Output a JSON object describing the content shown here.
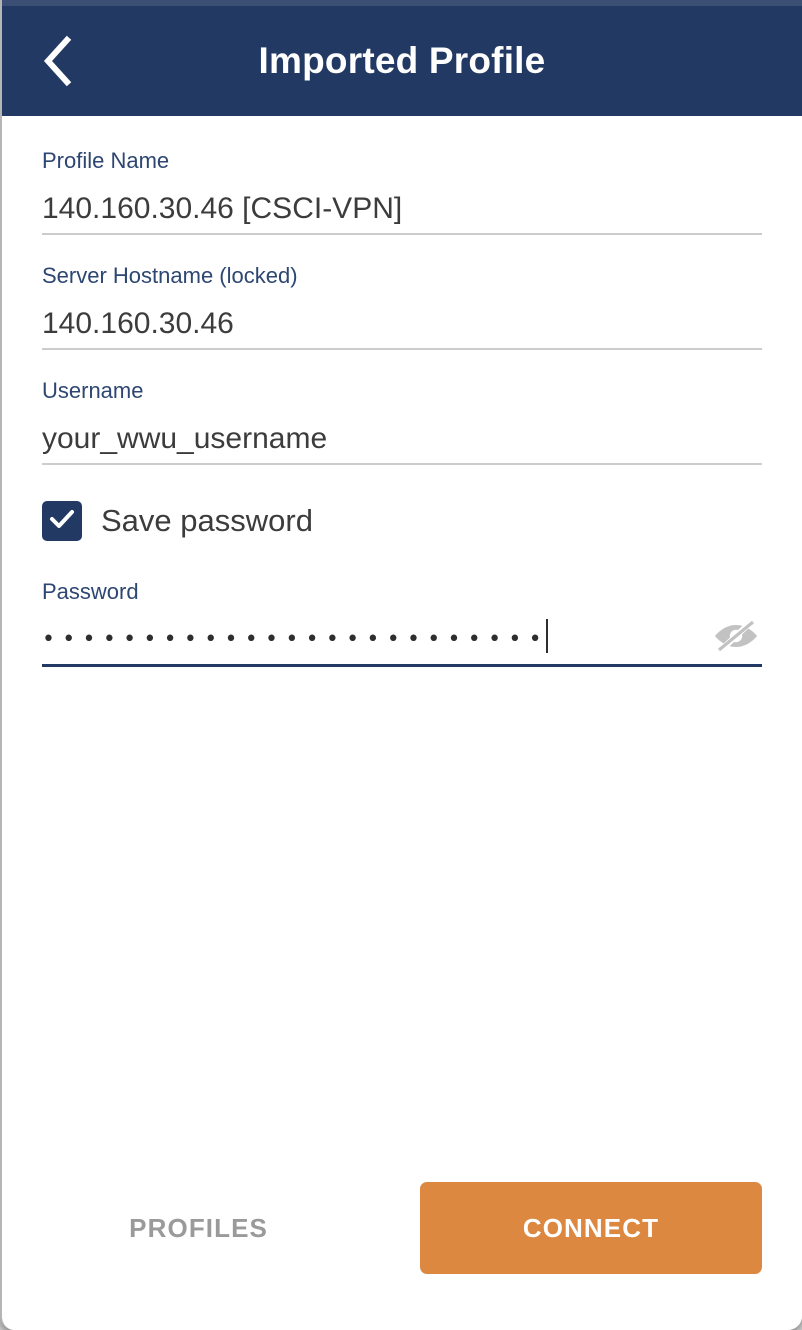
{
  "window": {
    "accent_navy": "#223a63",
    "accent_orange": "#dd8840",
    "background": "#ffffff"
  },
  "header": {
    "title": "Imported Profile",
    "back_icon": "chevron-left-icon"
  },
  "form": {
    "fields": [
      {
        "label": "Profile Name",
        "value": "140.160.30.46 [CSCI-VPN]",
        "focused": false
      },
      {
        "label": "Server Hostname (locked)",
        "value": "140.160.30.46",
        "focused": false
      },
      {
        "label": "Username",
        "value": "your_wwu_username",
        "focused": false
      }
    ],
    "save_password": {
      "label": "Save password",
      "checked": true,
      "check_icon": "checkmark-icon"
    },
    "password": {
      "label": "Password",
      "masked_value": "•••••••••••••••••••••••••",
      "character_count": 25,
      "focused": true,
      "visibility_icon": "eye-slash-icon",
      "visibility_state": "hidden"
    }
  },
  "footer": {
    "profiles_label": "PROFILES",
    "connect_label": "CONNECT"
  }
}
